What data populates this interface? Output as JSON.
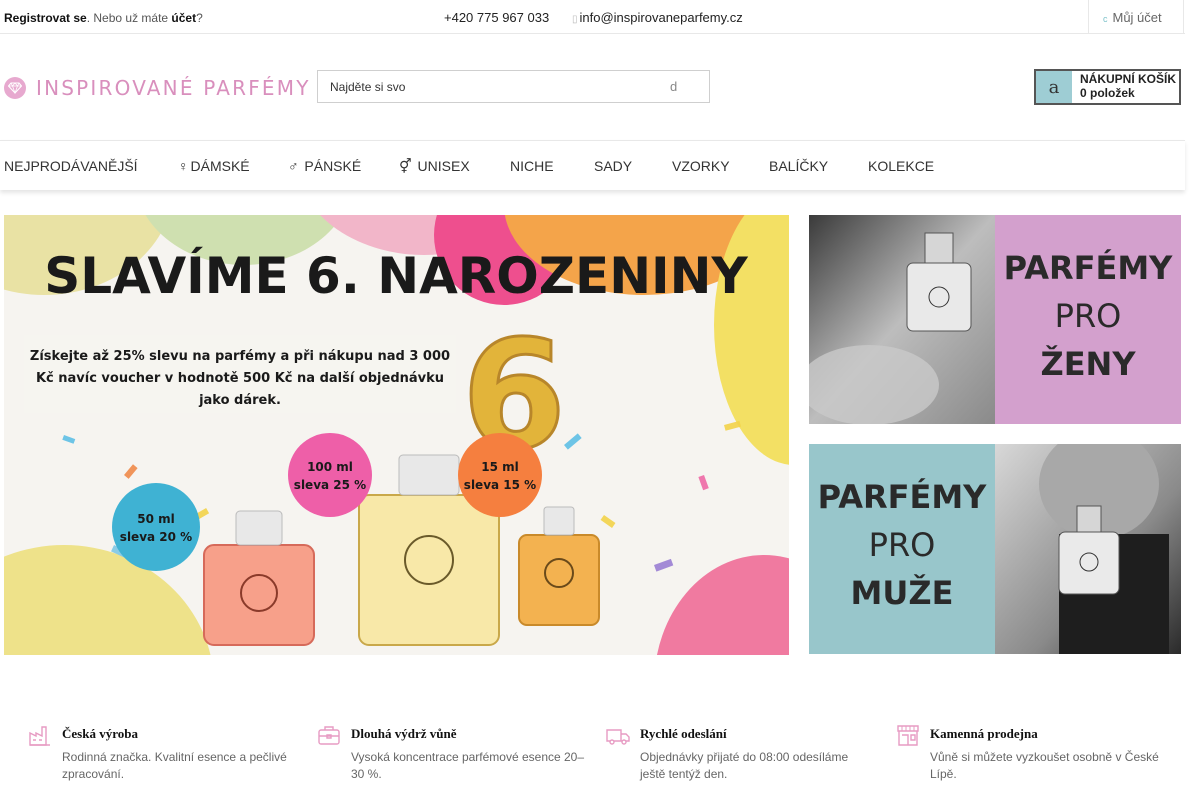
{
  "topbar": {
    "register": "Registrovat se",
    "middle": ". Nebo už máte ",
    "account_link": "účet",
    "question": "?",
    "phone": "+420 775 967 033",
    "email": "info@inspirovaneparfemy.cz",
    "my_account": "Můj účet"
  },
  "header": {
    "brand": "INSPIROVANÉ PARFÉMY",
    "search_placeholder": "Najděte si svo",
    "search_button_glyph": "d",
    "cart_icon_glyph": "a",
    "cart_title": "NÁKUPNÍ KOŠÍK",
    "cart_count": "0 položek"
  },
  "nav": {
    "items": [
      {
        "label": "NEJPRODÁVANĚJŠÍ",
        "symbol": ""
      },
      {
        "label": "DÁMSKÉ",
        "symbol": "♀"
      },
      {
        "label": "PÁNSKÉ",
        "symbol": "♂"
      },
      {
        "label": "UNISEX",
        "symbol": "⚥"
      },
      {
        "label": "NICHE",
        "symbol": ""
      },
      {
        "label": "SADY",
        "symbol": ""
      },
      {
        "label": "VZORKY",
        "symbol": ""
      },
      {
        "label": "BALÍČKY",
        "symbol": ""
      },
      {
        "label": "KOLEKCE",
        "symbol": ""
      }
    ]
  },
  "hero": {
    "title": "SLAVÍME 6. NAROZENINY",
    "promo_line1": "Získejte až 25% slevu na parfémy a při nákupu nad 3 000",
    "promo_line2": "Kč navíc voucher v hodnotě 500 Kč na další objednávku",
    "promo_line3": "jako dárek.",
    "number": "6",
    "badge_50_line1": "50 ml",
    "badge_50_line2": "sleva 20 %",
    "badge_100_line1": "100 ml",
    "badge_100_line2": "sleva 25 %",
    "badge_15_line1": "15 ml",
    "badge_15_line2": "sleva 15 %",
    "colors": {
      "badge_50": "#3fb2d3",
      "badge_100": "#ee5fa8",
      "badge_15": "#f57f3f"
    }
  },
  "side_banners": {
    "women_line1": "PARFÉMY",
    "women_line2": "PRO",
    "women_line3": "ŽENY",
    "men_line1": "PARFÉMY",
    "men_line2": "PRO",
    "men_line3": "MUŽE",
    "colors": {
      "women_bg": "#d3a0cd",
      "men_bg": "#98c6cb"
    }
  },
  "features": [
    {
      "title": "Česká výroba",
      "text": "Rodinná značka. Kvalitní esence a pečlivé zpracování.",
      "icon": "factory-icon"
    },
    {
      "title": "Dlouhá výdrž vůně",
      "text": "Vysoká koncentrace parfémové esence 20–30 %.",
      "icon": "briefcase-icon"
    },
    {
      "title": "Rychlé odeslání",
      "text": "Objednávky přijaté do 08:00 odesíláme ještě tentýž den.",
      "icon": "truck-icon"
    },
    {
      "title": "Kamenná prodejna",
      "text": "Vůně si můžete vyzkoušet osobně v České Lípě.",
      "icon": "store-icon"
    }
  ],
  "colors": {
    "brand_pink": "#d98fbd",
    "accent_teal": "#9ecdd4"
  }
}
